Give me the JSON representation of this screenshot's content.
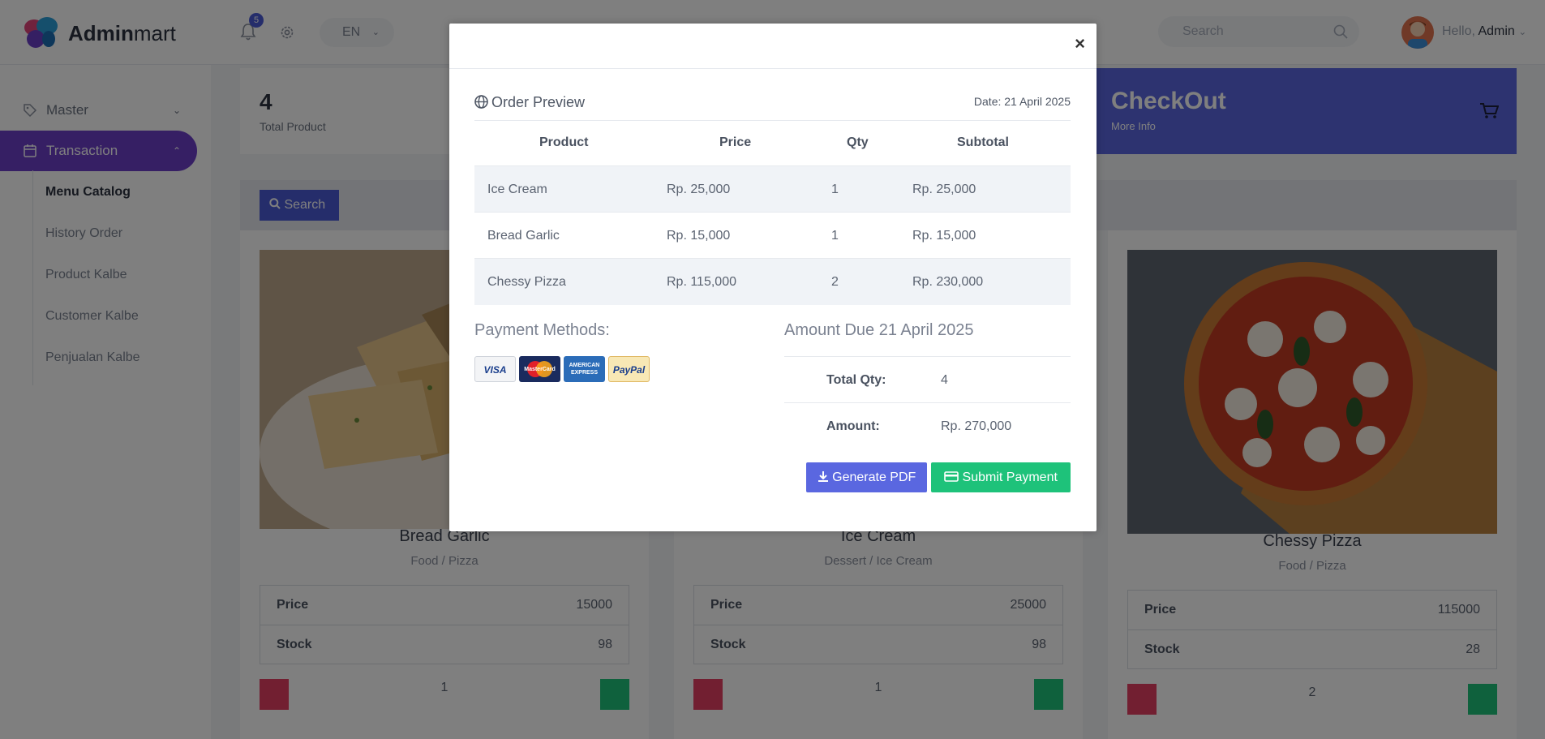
{
  "header": {
    "brand_bold": "Admin",
    "brand_rest": "mart",
    "notifications_count": "5",
    "language": "EN",
    "search_placeholder": "Search",
    "greeting": "Hello,",
    "user_name": "Admin"
  },
  "sidebar": {
    "items": [
      {
        "label": "Master"
      },
      {
        "label": "Transaction"
      }
    ],
    "sub_items": [
      {
        "label": "Menu Catalog"
      },
      {
        "label": "History Order"
      },
      {
        "label": "Product Kalbe"
      },
      {
        "label": "Customer Kalbe"
      },
      {
        "label": "Penjualan Kalbe"
      }
    ]
  },
  "stat": {
    "value": "4",
    "label": "Total Product"
  },
  "checkout": {
    "title": "CheckOut",
    "subtitle": "More Info"
  },
  "search_button": "Search",
  "products": [
    {
      "name": "Bread Garlic",
      "category": "Food / Pizza",
      "price_label": "Price",
      "price": "15000",
      "stock_label": "Stock",
      "stock": "98",
      "qty": "1"
    },
    {
      "name": "Ice Cream",
      "category": "Dessert / Ice Cream",
      "price_label": "Price",
      "price": "25000",
      "stock_label": "Stock",
      "stock": "98",
      "qty": "1"
    },
    {
      "name": "Chessy Pizza",
      "category": "Food / Pizza",
      "price_label": "Price",
      "price": "115000",
      "stock_label": "Stock",
      "stock": "28",
      "qty": "2"
    }
  ],
  "modal": {
    "title": "Order Preview",
    "date": "Date: 21 April 2025",
    "columns": [
      "Product",
      "Price",
      "Qty",
      "Subtotal"
    ],
    "rows": [
      {
        "product": "Ice Cream",
        "price": "Rp. 25,000",
        "qty": "1",
        "subtotal": "Rp. 25,000"
      },
      {
        "product": "Bread Garlic",
        "price": "Rp. 15,000",
        "qty": "1",
        "subtotal": "Rp. 15,000"
      },
      {
        "product": "Chessy Pizza",
        "price": "Rp. 115,000",
        "qty": "2",
        "subtotal": "Rp. 230,000"
      }
    ],
    "payment_title": "Payment Methods:",
    "payment_cards": [
      "VISA",
      "MasterCard",
      "AMERICAN EXPRESS",
      "PayPal"
    ],
    "amount_title": "Amount Due 21 April 2025",
    "total_qty_label": "Total Qty:",
    "total_qty": "4",
    "amount_label": "Amount:",
    "amount": "Rp. 270,000",
    "generate_pdf": "Generate PDF",
    "submit_payment": "Submit Payment",
    "close": "×"
  },
  "colors": {
    "primary": "#5a67e0",
    "success": "#1ec27a",
    "danger": "#e53e62",
    "active_nav": "#6c3ec9"
  }
}
